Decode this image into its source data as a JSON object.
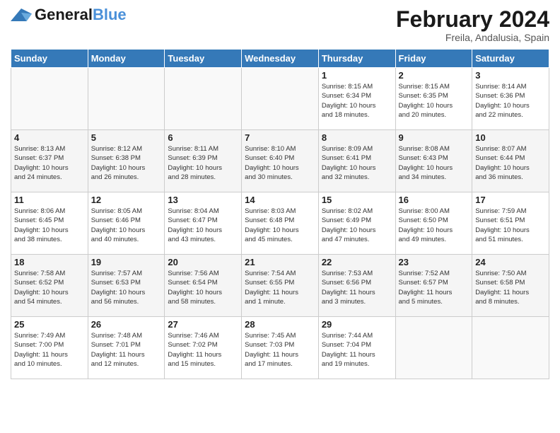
{
  "header": {
    "logo_general": "General",
    "logo_blue": "Blue",
    "month_title": "February 2024",
    "location": "Freila, Andalusia, Spain"
  },
  "weekdays": [
    "Sunday",
    "Monday",
    "Tuesday",
    "Wednesday",
    "Thursday",
    "Friday",
    "Saturday"
  ],
  "weeks": [
    [
      {
        "day": "",
        "info": ""
      },
      {
        "day": "",
        "info": ""
      },
      {
        "day": "",
        "info": ""
      },
      {
        "day": "",
        "info": ""
      },
      {
        "day": "1",
        "info": "Sunrise: 8:15 AM\nSunset: 6:34 PM\nDaylight: 10 hours\nand 18 minutes."
      },
      {
        "day": "2",
        "info": "Sunrise: 8:15 AM\nSunset: 6:35 PM\nDaylight: 10 hours\nand 20 minutes."
      },
      {
        "day": "3",
        "info": "Sunrise: 8:14 AM\nSunset: 6:36 PM\nDaylight: 10 hours\nand 22 minutes."
      }
    ],
    [
      {
        "day": "4",
        "info": "Sunrise: 8:13 AM\nSunset: 6:37 PM\nDaylight: 10 hours\nand 24 minutes."
      },
      {
        "day": "5",
        "info": "Sunrise: 8:12 AM\nSunset: 6:38 PM\nDaylight: 10 hours\nand 26 minutes."
      },
      {
        "day": "6",
        "info": "Sunrise: 8:11 AM\nSunset: 6:39 PM\nDaylight: 10 hours\nand 28 minutes."
      },
      {
        "day": "7",
        "info": "Sunrise: 8:10 AM\nSunset: 6:40 PM\nDaylight: 10 hours\nand 30 minutes."
      },
      {
        "day": "8",
        "info": "Sunrise: 8:09 AM\nSunset: 6:41 PM\nDaylight: 10 hours\nand 32 minutes."
      },
      {
        "day": "9",
        "info": "Sunrise: 8:08 AM\nSunset: 6:43 PM\nDaylight: 10 hours\nand 34 minutes."
      },
      {
        "day": "10",
        "info": "Sunrise: 8:07 AM\nSunset: 6:44 PM\nDaylight: 10 hours\nand 36 minutes."
      }
    ],
    [
      {
        "day": "11",
        "info": "Sunrise: 8:06 AM\nSunset: 6:45 PM\nDaylight: 10 hours\nand 38 minutes."
      },
      {
        "day": "12",
        "info": "Sunrise: 8:05 AM\nSunset: 6:46 PM\nDaylight: 10 hours\nand 40 minutes."
      },
      {
        "day": "13",
        "info": "Sunrise: 8:04 AM\nSunset: 6:47 PM\nDaylight: 10 hours\nand 43 minutes."
      },
      {
        "day": "14",
        "info": "Sunrise: 8:03 AM\nSunset: 6:48 PM\nDaylight: 10 hours\nand 45 minutes."
      },
      {
        "day": "15",
        "info": "Sunrise: 8:02 AM\nSunset: 6:49 PM\nDaylight: 10 hours\nand 47 minutes."
      },
      {
        "day": "16",
        "info": "Sunrise: 8:00 AM\nSunset: 6:50 PM\nDaylight: 10 hours\nand 49 minutes."
      },
      {
        "day": "17",
        "info": "Sunrise: 7:59 AM\nSunset: 6:51 PM\nDaylight: 10 hours\nand 51 minutes."
      }
    ],
    [
      {
        "day": "18",
        "info": "Sunrise: 7:58 AM\nSunset: 6:52 PM\nDaylight: 10 hours\nand 54 minutes."
      },
      {
        "day": "19",
        "info": "Sunrise: 7:57 AM\nSunset: 6:53 PM\nDaylight: 10 hours\nand 56 minutes."
      },
      {
        "day": "20",
        "info": "Sunrise: 7:56 AM\nSunset: 6:54 PM\nDaylight: 10 hours\nand 58 minutes."
      },
      {
        "day": "21",
        "info": "Sunrise: 7:54 AM\nSunset: 6:55 PM\nDaylight: 11 hours\nand 1 minute."
      },
      {
        "day": "22",
        "info": "Sunrise: 7:53 AM\nSunset: 6:56 PM\nDaylight: 11 hours\nand 3 minutes."
      },
      {
        "day": "23",
        "info": "Sunrise: 7:52 AM\nSunset: 6:57 PM\nDaylight: 11 hours\nand 5 minutes."
      },
      {
        "day": "24",
        "info": "Sunrise: 7:50 AM\nSunset: 6:58 PM\nDaylight: 11 hours\nand 8 minutes."
      }
    ],
    [
      {
        "day": "25",
        "info": "Sunrise: 7:49 AM\nSunset: 7:00 PM\nDaylight: 11 hours\nand 10 minutes."
      },
      {
        "day": "26",
        "info": "Sunrise: 7:48 AM\nSunset: 7:01 PM\nDaylight: 11 hours\nand 12 minutes."
      },
      {
        "day": "27",
        "info": "Sunrise: 7:46 AM\nSunset: 7:02 PM\nDaylight: 11 hours\nand 15 minutes."
      },
      {
        "day": "28",
        "info": "Sunrise: 7:45 AM\nSunset: 7:03 PM\nDaylight: 11 hours\nand 17 minutes."
      },
      {
        "day": "29",
        "info": "Sunrise: 7:44 AM\nSunset: 7:04 PM\nDaylight: 11 hours\nand 19 minutes."
      },
      {
        "day": "",
        "info": ""
      },
      {
        "day": "",
        "info": ""
      }
    ]
  ]
}
